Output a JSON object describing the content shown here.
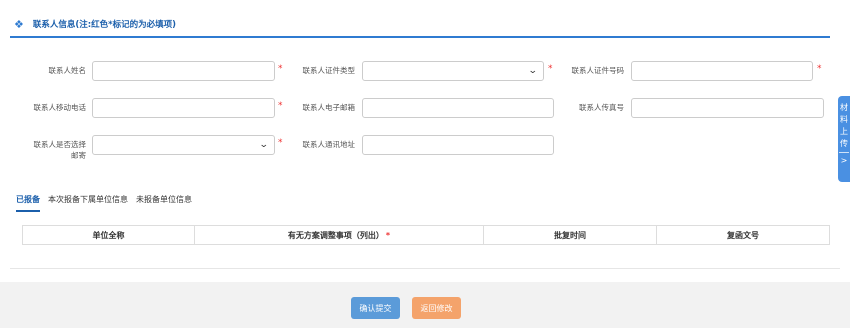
{
  "section": {
    "title": "联系人信息(注:红色*标记的为必填项)",
    "icon": "diamond-icon",
    "accent": "#2f7bd1"
  },
  "form": {
    "contact_name": {
      "label": "联系人姓名",
      "value": ""
    },
    "id_type": {
      "label": "联系人证件类型",
      "value": ""
    },
    "id_number": {
      "label": "联系人证件号码",
      "value": ""
    },
    "mobile": {
      "label": "联系人移动电话",
      "value": ""
    },
    "email": {
      "label": "联系人电子邮箱",
      "value": ""
    },
    "fax": {
      "label": "联系人传真号",
      "value": ""
    },
    "mail_select": {
      "label_line1": "联系人是否选择",
      "label_line2": "邮寄",
      "value": ""
    },
    "address": {
      "label": "联系人通讯地址",
      "value": ""
    },
    "required_mark": "*"
  },
  "sidetab": {
    "chars": [
      "材",
      "料",
      "上",
      "传"
    ],
    "arrow": ">"
  },
  "tabs": [
    "已报备",
    "本次报备下属单位信息",
    "未报备单位信息"
  ],
  "table": {
    "headers": [
      "单位全称",
      "有无方案调整事项（列出）",
      "批复时间",
      "复函文号"
    ],
    "required_mark": "*"
  },
  "buttons": {
    "confirm": "确认提交",
    "back": "返回修改"
  },
  "colors": {
    "confirm": "#5b9bd9",
    "back": "#f4a36b",
    "required": "#e33333"
  }
}
